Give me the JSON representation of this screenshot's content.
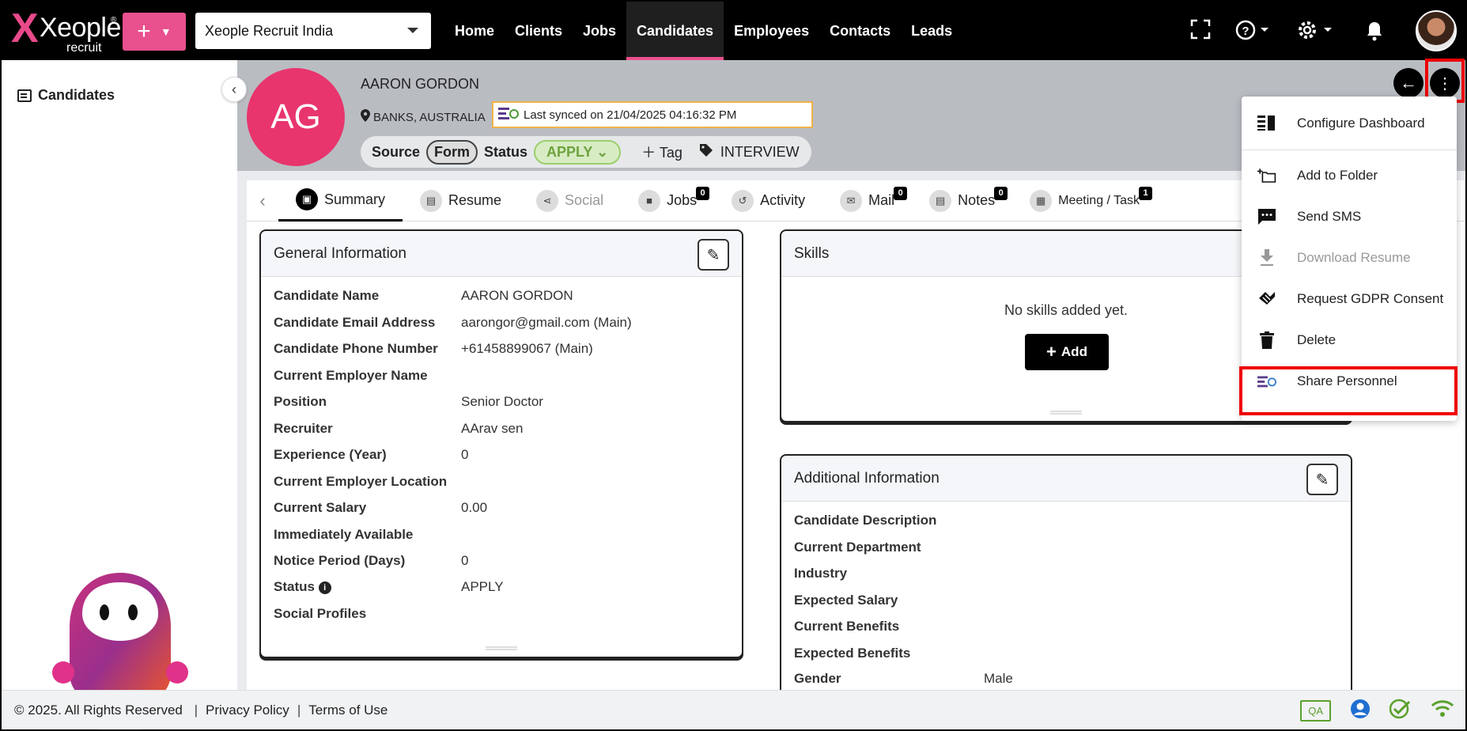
{
  "topbar": {
    "logo_text": "Xeople",
    "logo_sub": "recruit",
    "company": "Xeople Recruit India",
    "nav": [
      "Home",
      "Clients",
      "Jobs",
      "Candidates",
      "Employees",
      "Contacts",
      "Leads"
    ],
    "active_nav": "Candidates",
    "colors": {
      "accent": "#e8508e",
      "bar": "#000000"
    }
  },
  "sidebar": {
    "items": [
      {
        "label": "Candidates"
      }
    ]
  },
  "candidate": {
    "initials": "AG",
    "name": "AARON GORDON",
    "location": "BANKS, AUSTRALIA",
    "sync_text": "Last synced on 21/04/2025 04:16:32 PM",
    "source_label": "Source",
    "source_value": "Form",
    "status_label": "Status",
    "status_value": "APPLY",
    "tag_label": "Tag",
    "tag_value": "INTERVIEW"
  },
  "tabs": [
    {
      "label": "Summary",
      "badge": ""
    },
    {
      "label": "Resume",
      "badge": ""
    },
    {
      "label": "Social",
      "badge": ""
    },
    {
      "label": "Jobs",
      "badge": "0"
    },
    {
      "label": "Activity",
      "badge": ""
    },
    {
      "label": "Mail",
      "badge": "0"
    },
    {
      "label": "Notes",
      "badge": "0"
    },
    {
      "label": "Meeting / Task",
      "badge": "1"
    }
  ],
  "general": {
    "title": "General Information",
    "rows": [
      {
        "k": "Candidate Name",
        "v": "AARON GORDON"
      },
      {
        "k": "Candidate Email Address",
        "v": "aarongor@gmail.com (Main)"
      },
      {
        "k": "Candidate Phone Number",
        "v": "+61458899067 (Main)"
      },
      {
        "k": "Current Employer Name",
        "v": ""
      },
      {
        "k": "Position",
        "v": "Senior Doctor"
      },
      {
        "k": "Recruiter",
        "v": "AArav sen"
      },
      {
        "k": "Experience (Year)",
        "v": "0"
      },
      {
        "k": "Current Employer Location",
        "v": ""
      },
      {
        "k": "Current Salary",
        "v": "0.00"
      },
      {
        "k": "Immediately Available",
        "v": ""
      },
      {
        "k": "Notice Period (Days)",
        "v": "0"
      },
      {
        "k": "Status",
        "v": "APPLY"
      },
      {
        "k": "Social Profiles",
        "v": ""
      }
    ]
  },
  "skills": {
    "title": "Skills",
    "empty": "No skills added yet.",
    "add": "Add"
  },
  "additional": {
    "title": "Additional Information",
    "rows": [
      {
        "k": "Candidate Description",
        "v": ""
      },
      {
        "k": "Current Department",
        "v": ""
      },
      {
        "k": "Industry",
        "v": ""
      },
      {
        "k": "Expected Salary",
        "v": ""
      },
      {
        "k": "Current Benefits",
        "v": ""
      },
      {
        "k": "Expected Benefits",
        "v": ""
      },
      {
        "k": "Gender",
        "v": "Male"
      }
    ]
  },
  "menu": [
    {
      "label": "Configure Dashboard",
      "icon": "dashboard-icon"
    },
    {
      "label": "Add to Folder",
      "icon": "folder-add-icon"
    },
    {
      "label": "Send SMS",
      "icon": "sms-icon"
    },
    {
      "label": "Download Resume",
      "icon": "download-icon"
    },
    {
      "label": "Request GDPR Consent",
      "icon": "handshake-icon"
    },
    {
      "label": "Delete",
      "icon": "trash-icon"
    },
    {
      "label": "Share Personnel",
      "icon": "share-personnel-icon"
    }
  ],
  "footer": {
    "copyright": "© 2025. All Rights Reserved",
    "privacy": "Privacy Policy",
    "terms": "Terms of Use",
    "env": "QA"
  }
}
